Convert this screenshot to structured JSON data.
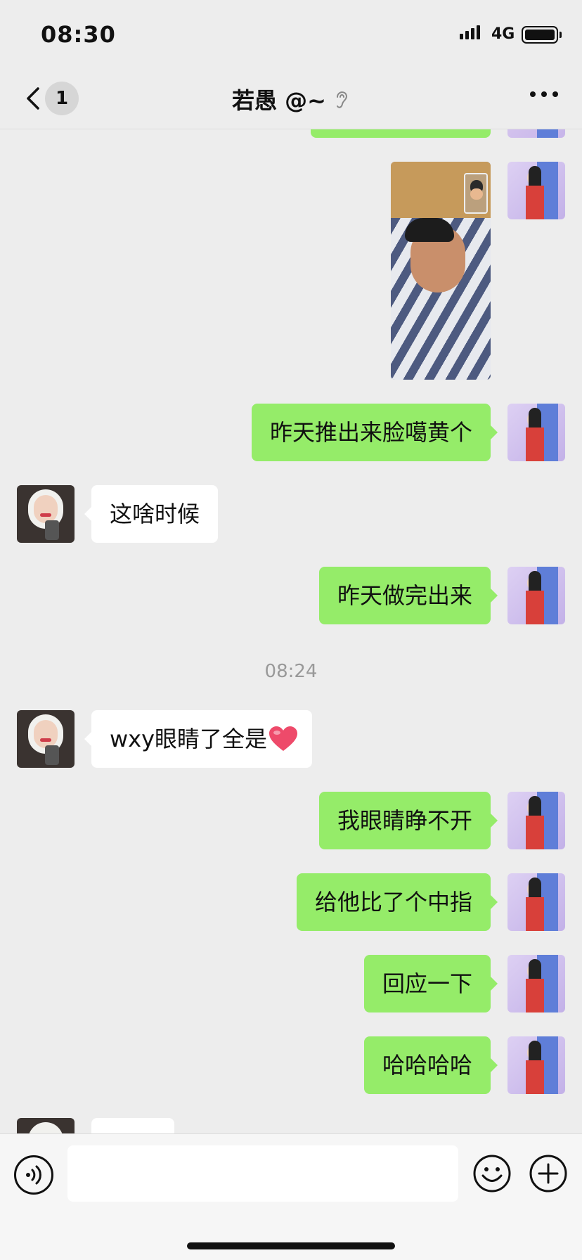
{
  "status_bar": {
    "time": "08:30",
    "network": "4G",
    "battery_level": 0.9
  },
  "nav": {
    "unread_count": "1",
    "title": "若愚 @~"
  },
  "messages": [
    {
      "side": "right",
      "type": "image",
      "description": "photo"
    },
    {
      "side": "right",
      "type": "text",
      "text": "昨天推出来脸噶黄个"
    },
    {
      "side": "left",
      "type": "text",
      "text": "这啥时候"
    },
    {
      "side": "right",
      "type": "text",
      "text": "昨天做完出来"
    },
    {
      "type": "time",
      "text": "08:24"
    },
    {
      "side": "left",
      "type": "text",
      "text": "wxy眼睛了全是"
    },
    {
      "side": "right",
      "type": "text",
      "text": "我眼睛睁不开"
    },
    {
      "side": "right",
      "type": "text",
      "text": "给他比了个中指"
    },
    {
      "side": "right",
      "type": "text",
      "text": "回应一下"
    },
    {
      "side": "right",
      "type": "text",
      "text": "哈哈哈哈"
    }
  ],
  "input": {
    "value": "",
    "placeholder": ""
  },
  "icons": {
    "back": "chevron-left-icon",
    "ear": "ear-icon",
    "more": "more-icon",
    "voice": "voice-icon",
    "emoji": "emoji-icon",
    "plus": "plus-icon",
    "heart": "heart-icon"
  },
  "colors": {
    "background": "#ededed",
    "sent_bubble": "#95ec69",
    "received_bubble": "#ffffff",
    "timestamp": "#999999"
  }
}
